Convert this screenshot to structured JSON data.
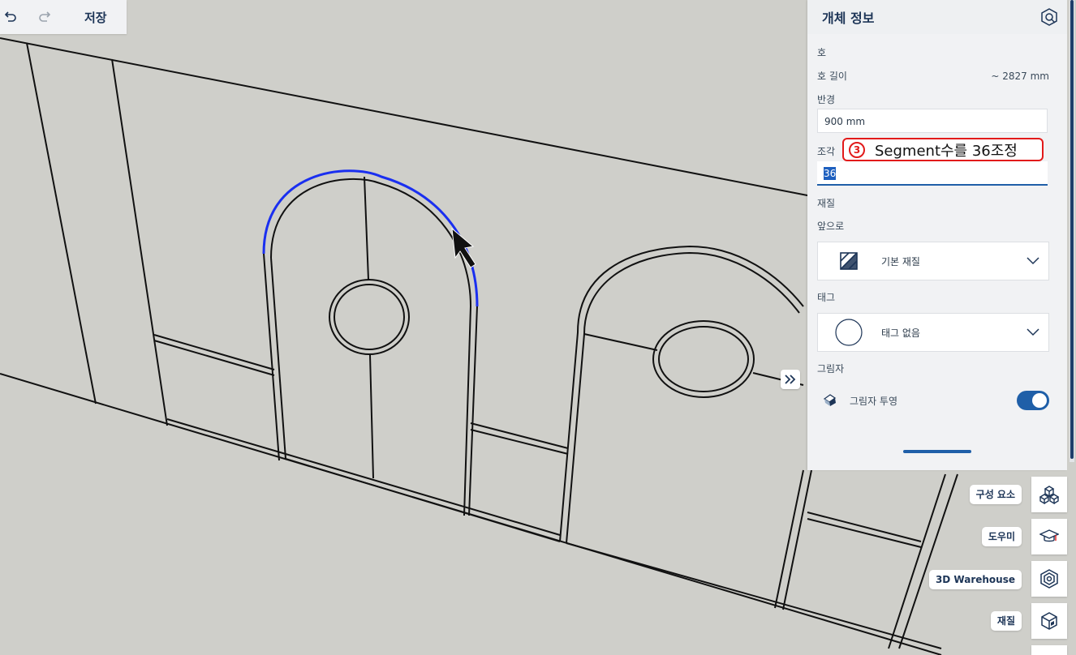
{
  "toolbar": {
    "undo_icon": "undo-icon",
    "redo_icon": "redo-icon",
    "save_label": "저장"
  },
  "panel": {
    "title": "개체 정보",
    "header_icon": "entity-info-icon",
    "arc_section": "호",
    "arc_length_label": "호 길이",
    "arc_length_value": "~ 2827 mm",
    "radius_label": "반경",
    "radius_value": "900 mm",
    "segments_label": "조각",
    "segments_value": "36",
    "material_section": "재질",
    "front_label": "앞으로",
    "material_value": "기본 재질",
    "tag_section": "태그",
    "tag_value": "태그 없음",
    "shadow_section": "그림자",
    "shadow_cast_label": "그림자 투영",
    "shadow_cast_on": true
  },
  "annotation": {
    "number": "3",
    "text": "Segment수를 36조정"
  },
  "tray": {
    "components_label": "구성 요소",
    "instructor_label": "도우미",
    "warehouse_label": "3D Warehouse",
    "materials_label": "재질"
  },
  "colors": {
    "accent": "#1f5fa8",
    "selected_edge": "#1a2ff0",
    "annotation_red": "#e21a1a",
    "canvas_bg": "#cfcfca"
  }
}
